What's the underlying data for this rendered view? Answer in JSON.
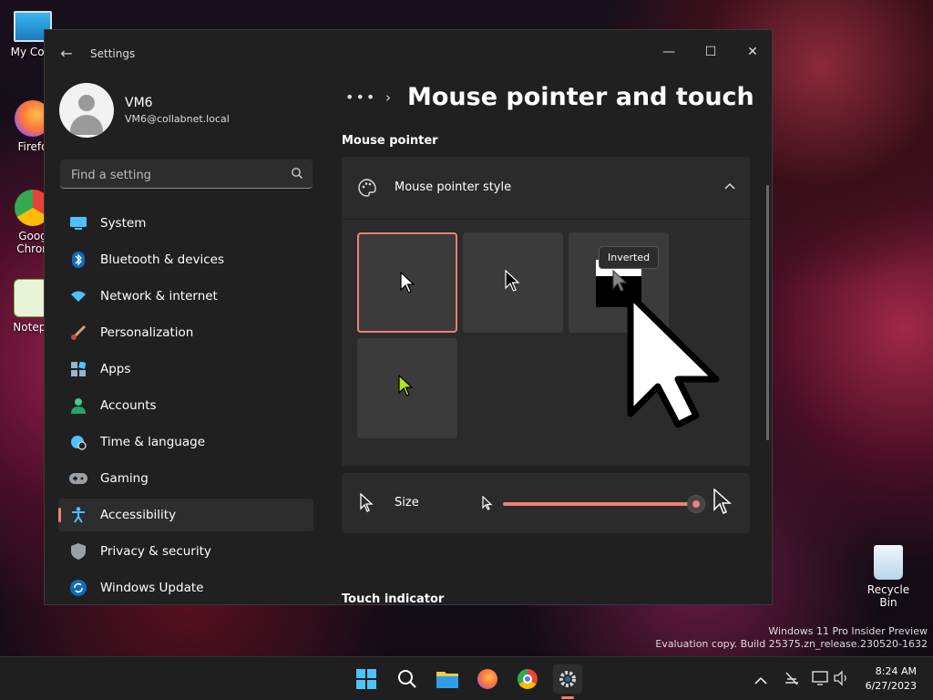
{
  "desktop": {
    "icons": [
      {
        "label": "My Com"
      },
      {
        "label": "Firefo"
      },
      {
        "label": "Goog Chron"
      },
      {
        "label": "Notepa"
      },
      {
        "label": "Recycle Bin"
      }
    ],
    "watermark_line1": "Windows 11 Pro Insider Preview",
    "watermark_line2": "Evaluation copy. Build 25375.zn_release.230520-1632"
  },
  "window": {
    "title": "Settings",
    "controls": {
      "minimize": "—",
      "maximize": "☐",
      "close": "✕"
    }
  },
  "user": {
    "name": "VM6",
    "email": "VM6@collabnet.local"
  },
  "search": {
    "placeholder": "Find a setting"
  },
  "nav": {
    "items": [
      {
        "label": "System",
        "icon": "system-icon"
      },
      {
        "label": "Bluetooth & devices",
        "icon": "bluetooth-icon"
      },
      {
        "label": "Network & internet",
        "icon": "wifi-icon"
      },
      {
        "label": "Personalization",
        "icon": "brush-icon"
      },
      {
        "label": "Apps",
        "icon": "apps-icon"
      },
      {
        "label": "Accounts",
        "icon": "person-icon"
      },
      {
        "label": "Time & language",
        "icon": "globe-clock-icon"
      },
      {
        "label": "Gaming",
        "icon": "gamepad-icon"
      },
      {
        "label": "Accessibility",
        "icon": "accessibility-icon",
        "active": true
      },
      {
        "label": "Privacy & security",
        "icon": "shield-icon"
      },
      {
        "label": "Windows Update",
        "icon": "update-icon"
      }
    ]
  },
  "content": {
    "breadcrumb_more": "•••",
    "breadcrumb_sep": "›",
    "title": "Mouse pointer and touch",
    "section_pointer": "Mouse pointer",
    "pointer_style_label": "Mouse pointer style",
    "styles": [
      {
        "name": "White",
        "selected": true
      },
      {
        "name": "Black"
      },
      {
        "name": "Inverted"
      },
      {
        "name": "Custom",
        "color": "#b6e21f"
      }
    ],
    "tooltip": "Inverted",
    "size_label": "Size",
    "size_value": 1.0,
    "section_touch": "Touch indicator"
  },
  "taskbar": {
    "time": "8:24 AM",
    "date": "6/27/2023",
    "accent": "#f08070"
  }
}
